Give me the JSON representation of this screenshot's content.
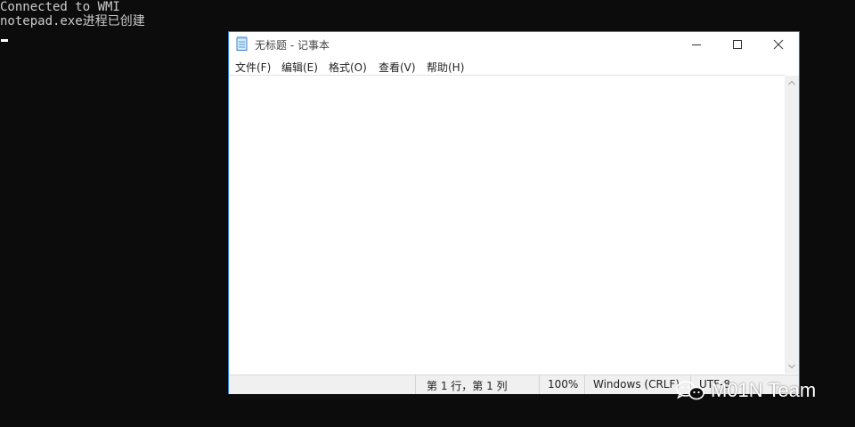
{
  "console": {
    "lines": [
      "Connected to WMI",
      "notepad.exe进程已创建"
    ]
  },
  "notepad": {
    "title": "无标题 - 记事本",
    "menu": [
      "文件(F)",
      "编辑(E)",
      "格式(O)",
      "查看(V)",
      "帮助(H)"
    ],
    "editor_text": "",
    "status": {
      "position": "第 1 行，第 1 列",
      "zoom": "100%",
      "line_ending": "Windows (CRLF)",
      "encoding": "UTF-8"
    }
  },
  "watermark": {
    "text": "M01N Team",
    "icon": "wechat-icon"
  },
  "colors": {
    "console_bg": "#0c0c0c",
    "console_text": "#cccccc",
    "window_border": "#2b79d1",
    "statusbar_bg": "#f0f0f0"
  }
}
